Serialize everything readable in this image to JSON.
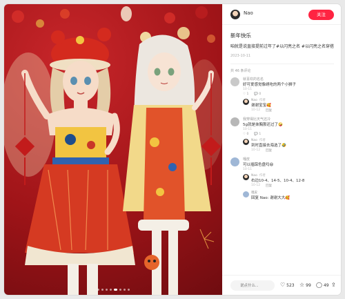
{
  "author": {
    "name": "Nao",
    "follow_label": "关注"
  },
  "post": {
    "title": "新年快乐",
    "desc": "咱就是说直接提前过年了#以闪亮之名 #以闪亮之名穿搭",
    "date": "2023-10-11"
  },
  "comments_count_label": "共 46 条评论",
  "comments": [
    {
      "name": "就喜欢的名名",
      "text": "好可爱感觉像绣吃的两个小狮子",
      "date": "10-11",
      "likes": "1",
      "replies_count": "0",
      "avatar_color": "#c9c9c9",
      "reply": {
        "name": "Nao",
        "tag": "作者",
        "text": "谢谢宝宝🥰",
        "date": "10-12",
        "action": "回复"
      }
    },
    {
      "name": "我穿得比天气还冷",
      "text": "5g就是抹胸那还过了🤪",
      "date": "10-11",
      "likes": "0",
      "replies_count": "1",
      "avatar_color": "#b7b7b7",
      "reply": {
        "name": "Nao",
        "tag": "作者",
        "text": "到时直接去海选了🤣",
        "date": "10-12",
        "action": "回复"
      }
    },
    {
      "name": "嘎皮",
      "text": "可以插踩色盘吗😄",
      "date": "10-11",
      "likes": "",
      "replies_count": "",
      "avatar_color": "#9fb7d6",
      "reply": {
        "name": "Nao",
        "tag": "作者",
        "text": "右边10-4、14-5、10-4、12-8",
        "date": "10-12",
        "action": "回复"
      },
      "reply2": {
        "name": "嘎皮",
        "tag": "",
        "text": "回复 Nao: 谢谢大大🥰",
        "date": "",
        "action": ""
      }
    }
  ],
  "footer": {
    "placeholder": "说点什么...",
    "likes": "523",
    "favorites": "99",
    "comments": "49"
  },
  "icons": {
    "like": "heart-icon",
    "favorite": "star-icon",
    "comment": "chat-bubble-icon",
    "share": "share-icon",
    "edit": "pen-icon"
  },
  "colors": {
    "accent": "#ff2442",
    "photo_bg": "#a5161b"
  },
  "carousel": {
    "total": 8,
    "active": 5
  }
}
